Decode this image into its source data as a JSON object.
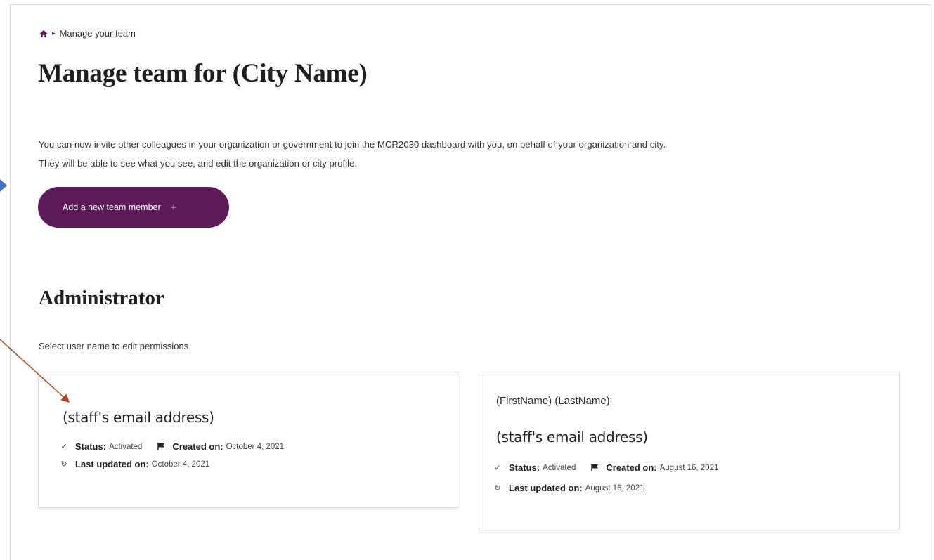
{
  "breadcrumb": {
    "home_icon": "home-icon",
    "current": "Manage your team"
  },
  "page": {
    "title": "Manage team for (City Name)",
    "intro_line1": "You can now invite other colleagues in your organization or government to join the MCR2030 dashboard with you, on behalf of your organization and city.",
    "intro_line2": "They will be able to see what you see, and edit the organization or city profile.",
    "add_button_label": "Add a new team member",
    "add_button_icon": "+"
  },
  "administrator": {
    "title": "Administrator",
    "helper": "Select user name to edit permissions.",
    "cards": [
      {
        "name": "",
        "email": "(staff's email address)",
        "status_label": "Status:",
        "status_value": "Activated",
        "created_label": "Created on:",
        "created_value": "October 4, 2021",
        "updated_label": "Last updated on:",
        "updated_value": "October 4, 2021"
      },
      {
        "name": "(FirstName) (LastName)",
        "email": "(staff's email address)",
        "status_label": "Status:",
        "status_value": "Activated",
        "created_label": "Created on:",
        "created_value": "August 16, 2021",
        "updated_label": "Last updated on:",
        "updated_value": "August 16, 2021"
      }
    ]
  },
  "colors": {
    "brand": "#5c1a58",
    "annotation_blue": "#4472c4",
    "annotation_red": "#b0431f"
  }
}
